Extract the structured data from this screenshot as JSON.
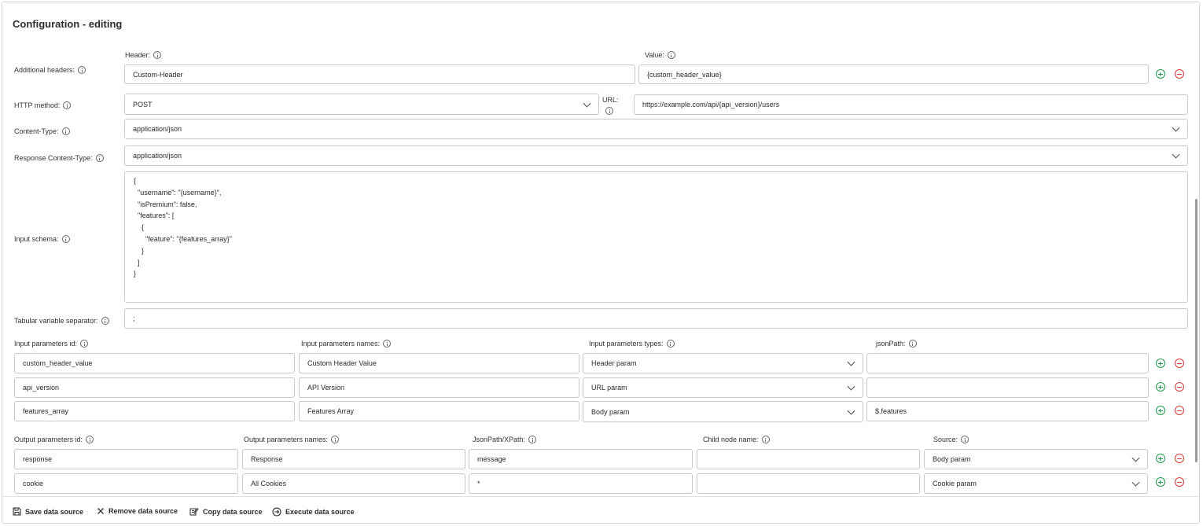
{
  "page": {
    "title": "Configuration - editing"
  },
  "headers": {
    "label": "Additional headers:",
    "header_col": "Header:",
    "value_col": "Value:",
    "header": "Custom-Header",
    "value": "{custom_header_value}"
  },
  "http": {
    "label": "HTTP method:",
    "method": "POST",
    "url_label": "URL:",
    "url": "https://example.com/api/{api_version}/users"
  },
  "content_type": {
    "label": "Content-Type:",
    "value": "application/json"
  },
  "response_content_type": {
    "label": "Response Content-Type:",
    "value": "application/json"
  },
  "input_schema": {
    "label": "Input schema:",
    "value": "{\n  \"username\": \"{username}\",\n  \"isPremium\": false,\n  \"features\": [\n    {\n      \"feature\": \"{features_array}\"\n    }\n  ]\n}"
  },
  "separator": {
    "label": "Tabular variable separator:",
    "value": ";"
  },
  "input_params": {
    "headers": {
      "id": "Input parameters id:",
      "names": "Input parameters names:",
      "types": "Input parameters types:",
      "jsonpath": "jsonPath:"
    },
    "rows": [
      {
        "id": "custom_header_value",
        "name": "Custom Header Value",
        "type": "Header param",
        "jsonpath": ""
      },
      {
        "id": "api_version",
        "name": "API Version",
        "type": "URL param",
        "jsonpath": ""
      },
      {
        "id": "features_array",
        "name": "Features Array",
        "type": "Body param",
        "jsonpath": "$.features"
      }
    ]
  },
  "output_params": {
    "headers": {
      "id": "Output parameters id:",
      "names": "Output parameters names:",
      "path": "JsonPath/XPath:",
      "child": "Child node name:",
      "source": "Source:"
    },
    "rows": [
      {
        "id": "response",
        "name": "Response",
        "path": "message",
        "child": "",
        "source": "Body param"
      },
      {
        "id": "cookie",
        "name": "All Cookies",
        "path": "*",
        "child": "",
        "source": "Cookie param"
      }
    ]
  },
  "footer": {
    "save": "Save data source",
    "remove": "Remove data source",
    "copy": "Copy data source",
    "execute": "Execute data source"
  },
  "icons": {
    "info": "info-icon",
    "add": "add-circle-icon",
    "remove": "remove-circle-icon",
    "chevron": "chevron-down-icon",
    "save": "floppy-disk-icon",
    "close": "close-icon",
    "copy": "copy-edit-icon",
    "execute": "arrow-circle-icon"
  },
  "colors": {
    "add": "#1e9e4a",
    "remove": "#d93a3a",
    "border": "#c9c9c9"
  }
}
